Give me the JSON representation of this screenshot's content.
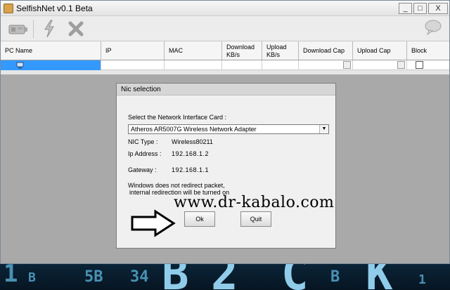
{
  "window": {
    "title": "SelfishNet v0.1 Beta",
    "controls": {
      "minimize": "_",
      "maximize": "□",
      "close": "X"
    }
  },
  "toolbar": {
    "icons": [
      "network-card-icon",
      "lightning-icon",
      "cross-icon",
      "chat-bubble-icon"
    ]
  },
  "grid": {
    "columns": [
      "PC Name",
      "IP",
      "MAC",
      "Download KB/s",
      "Upload KB/s",
      "Download Cap",
      "Upload Cap",
      "Block"
    ]
  },
  "dialog": {
    "title": "Nic selection",
    "select_label": "Select the Network Interface Card :",
    "selected_nic": "Atheros AR5007G Wireless Network Adapter",
    "nic_type_label": "NIC Type :",
    "nic_type_value": "Wireless80211",
    "ip_label": "Ip Address :",
    "ip_value": "192.168.1.2",
    "gateway_label": "Gateway :",
    "gateway_value": "192.168.1.1",
    "note_line1": "Windows does not redirect packet,",
    "note_line2": "internal redirection will be turned on",
    "ok_label": "Ok",
    "quit_label": "Quit"
  },
  "watermark": "www.dr-kabalo.com",
  "colors": {
    "selection": "#3399ff",
    "grid_background": "#a9a9a9"
  }
}
